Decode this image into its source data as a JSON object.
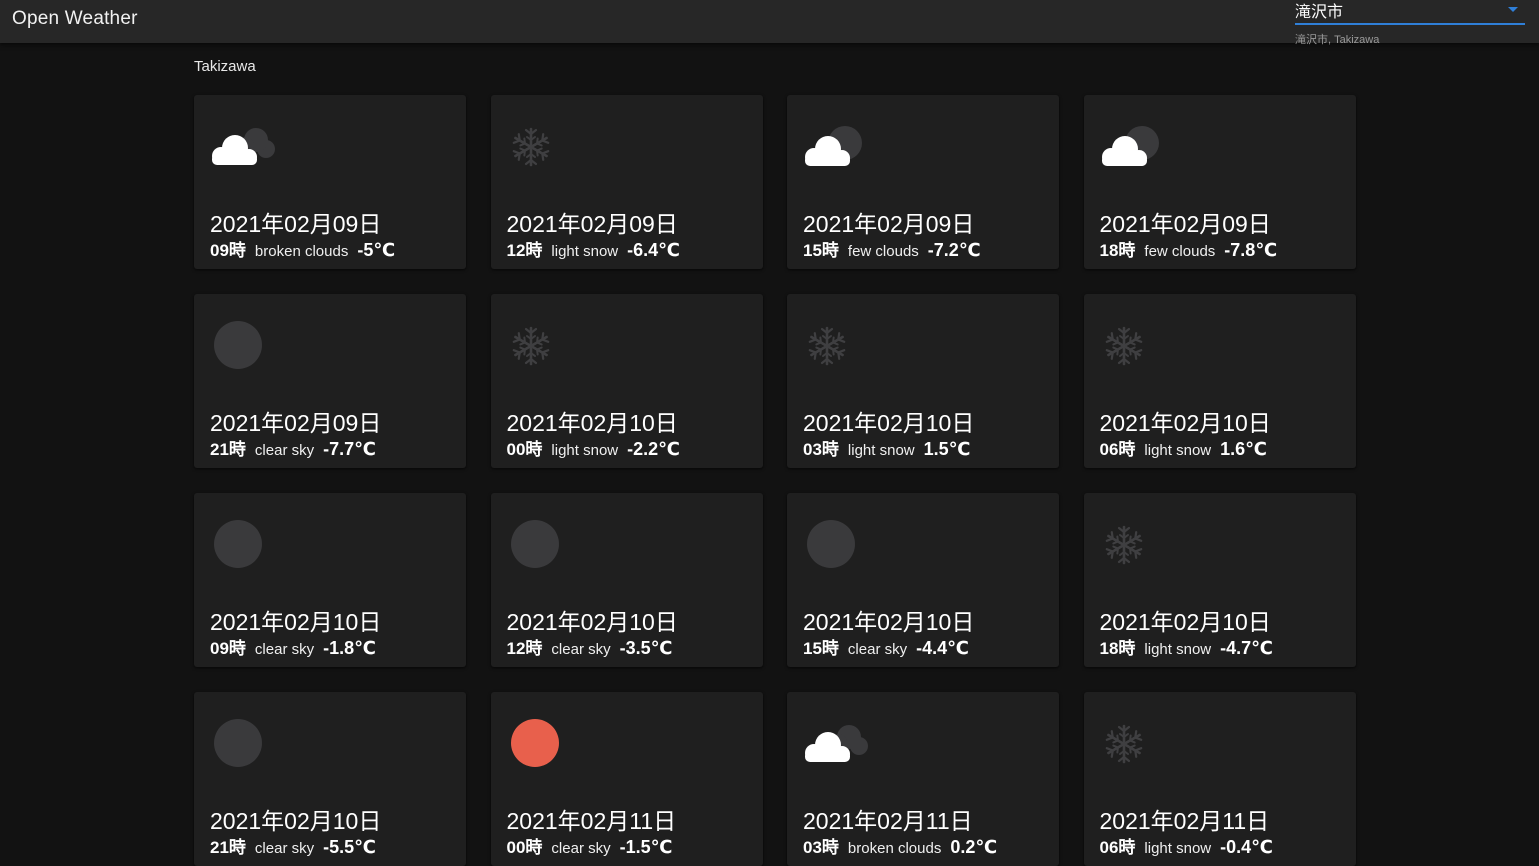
{
  "app": {
    "title": "Open Weather",
    "city_select_value": "滝沢市",
    "city_select_helper": "滝沢市, Takizawa"
  },
  "location": "Takizawa",
  "colors": {
    "accent": "#2f7fd8",
    "moon": "#3a3a3c",
    "sun": "#e8604c",
    "cloud": "#ffffff",
    "snow": "#3f3f41"
  },
  "forecast": [
    {
      "date": "2021年02月09日",
      "hour": "09時",
      "desc": "broken clouds",
      "temp": "-5℃",
      "icon": "broken-clouds-icon"
    },
    {
      "date": "2021年02月09日",
      "hour": "12時",
      "desc": "light snow",
      "temp": "-6.4℃",
      "icon": "snow-icon"
    },
    {
      "date": "2021年02月09日",
      "hour": "15時",
      "desc": "few clouds",
      "temp": "-7.2℃",
      "icon": "few-clouds-night-icon"
    },
    {
      "date": "2021年02月09日",
      "hour": "18時",
      "desc": "few clouds",
      "temp": "-7.8℃",
      "icon": "few-clouds-night-icon"
    },
    {
      "date": "2021年02月09日",
      "hour": "21時",
      "desc": "clear sky",
      "temp": "-7.7℃",
      "icon": "moon-icon"
    },
    {
      "date": "2021年02月10日",
      "hour": "00時",
      "desc": "light snow",
      "temp": "-2.2℃",
      "icon": "snow-icon"
    },
    {
      "date": "2021年02月10日",
      "hour": "03時",
      "desc": "light snow",
      "temp": "1.5℃",
      "icon": "snow-icon"
    },
    {
      "date": "2021年02月10日",
      "hour": "06時",
      "desc": "light snow",
      "temp": "1.6℃",
      "icon": "snow-icon"
    },
    {
      "date": "2021年02月10日",
      "hour": "09時",
      "desc": "clear sky",
      "temp": "-1.8℃",
      "icon": "moon-icon"
    },
    {
      "date": "2021年02月10日",
      "hour": "12時",
      "desc": "clear sky",
      "temp": "-3.5℃",
      "icon": "moon-icon"
    },
    {
      "date": "2021年02月10日",
      "hour": "15時",
      "desc": "clear sky",
      "temp": "-4.4℃",
      "icon": "moon-icon"
    },
    {
      "date": "2021年02月10日",
      "hour": "18時",
      "desc": "light snow",
      "temp": "-4.7℃",
      "icon": "snow-icon"
    },
    {
      "date": "2021年02月10日",
      "hour": "21時",
      "desc": "clear sky",
      "temp": "-5.5℃",
      "icon": "moon-icon"
    },
    {
      "date": "2021年02月11日",
      "hour": "00時",
      "desc": "clear sky",
      "temp": "-1.5℃",
      "icon": "sun-icon"
    },
    {
      "date": "2021年02月11日",
      "hour": "03時",
      "desc": "broken clouds",
      "temp": "0.2℃",
      "icon": "broken-clouds-icon"
    },
    {
      "date": "2021年02月11日",
      "hour": "06時",
      "desc": "light snow",
      "temp": "-0.4℃",
      "icon": "snow-icon"
    }
  ]
}
